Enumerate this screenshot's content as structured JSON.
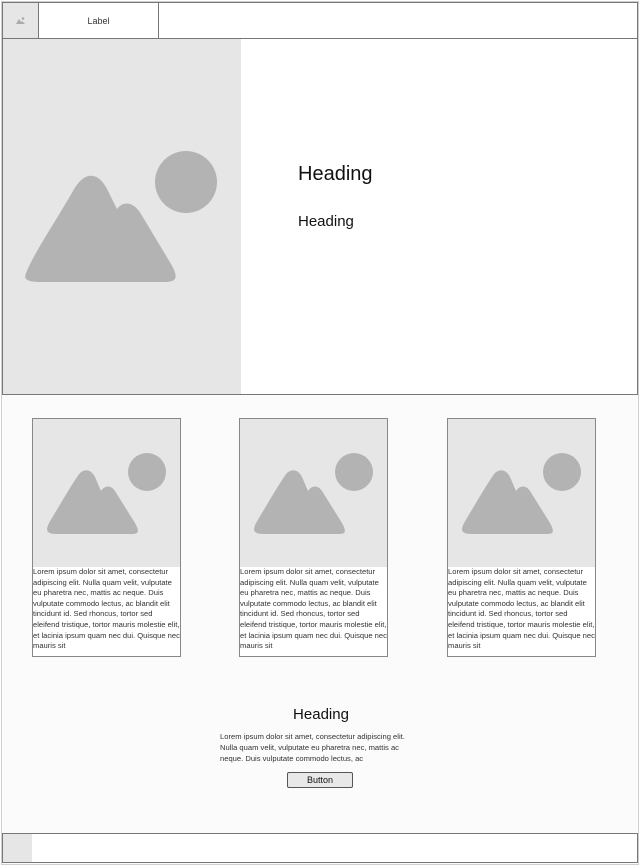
{
  "nav": {
    "tab_label": "Label",
    "icon": "image-placeholder-icon"
  },
  "hero": {
    "heading": "Heading",
    "subheading": "Heading",
    "image_icon": "image-placeholder-icon"
  },
  "cards": [
    {
      "text": "Lorem ipsum dolor sit amet, consectetur adipiscing elit. Nulla quam velit, vulputate eu pharetra nec, mattis ac neque. Duis vulputate commodo lectus, ac blandit elit tincidunt id. Sed rhoncus, tortor sed eleifend tristique, tortor mauris molestie elit, et lacinia ipsum quam nec dui. Quisque nec mauris sit"
    },
    {
      "text": "Lorem ipsum dolor sit amet, consectetur adipiscing elit. Nulla quam velit, vulputate eu pharetra nec, mattis ac neque. Duis vulputate commodo lectus, ac blandit elit tincidunt id. Sed rhoncus, tortor sed eleifend tristique, tortor mauris molestie elit, et lacinia ipsum quam nec dui. Quisque nec mauris sit"
    },
    {
      "text": "Lorem ipsum dolor sit amet, consectetur adipiscing elit. Nulla quam velit, vulputate eu pharetra nec, mattis ac neque. Duis vulputate commodo lectus, ac blandit elit tincidunt id. Sed rhoncus, tortor sed eleifend tristique, tortor mauris molestie elit, et lacinia ipsum quam nec dui. Quisque nec mauris sit"
    }
  ],
  "section": {
    "heading": "Heading",
    "text": "Lorem ipsum dolor sit amet, consectetur adipiscing elit. Nulla quam velit, vulputate eu pharetra nec, mattis ac neque. Duis vulputate commodo lectus, ac",
    "button_label": "Button"
  },
  "colors": {
    "placeholder_bg": "#e6e6e6",
    "placeholder_shape": "#b3b3b3",
    "border": "#777777"
  }
}
